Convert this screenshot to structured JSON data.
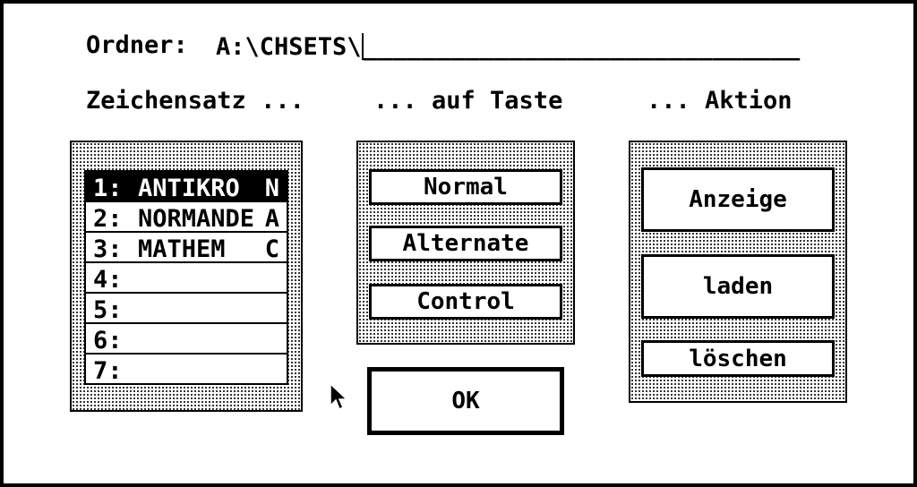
{
  "folder": {
    "label": "Ordner:",
    "path": "A:\\CHSETS\\",
    "underline": "______________________________"
  },
  "headings": {
    "charset": "Zeichensatz ...",
    "key": "... auf Taste",
    "action": "... Aktion"
  },
  "charsets": [
    {
      "num": "1:",
      "name": "ANTIKRO",
      "key": "N",
      "selected": true
    },
    {
      "num": "2:",
      "name": "NORMANDE",
      "key": "A",
      "selected": false
    },
    {
      "num": "3:",
      "name": "MATHEM",
      "key": "C",
      "selected": false
    },
    {
      "num": "4:",
      "name": "",
      "key": "",
      "selected": false
    },
    {
      "num": "5:",
      "name": "",
      "key": "",
      "selected": false
    },
    {
      "num": "6:",
      "name": "",
      "key": "",
      "selected": false
    },
    {
      "num": "7:",
      "name": "",
      "key": "",
      "selected": false
    }
  ],
  "keys": {
    "normal": "Normal",
    "alternate": "Alternate",
    "control": "Control"
  },
  "actions": {
    "show": "Anzeige",
    "load": "laden",
    "delete": "löschen"
  },
  "ok": "OK",
  "icons": {
    "cursor": "arrow-cursor-icon"
  }
}
